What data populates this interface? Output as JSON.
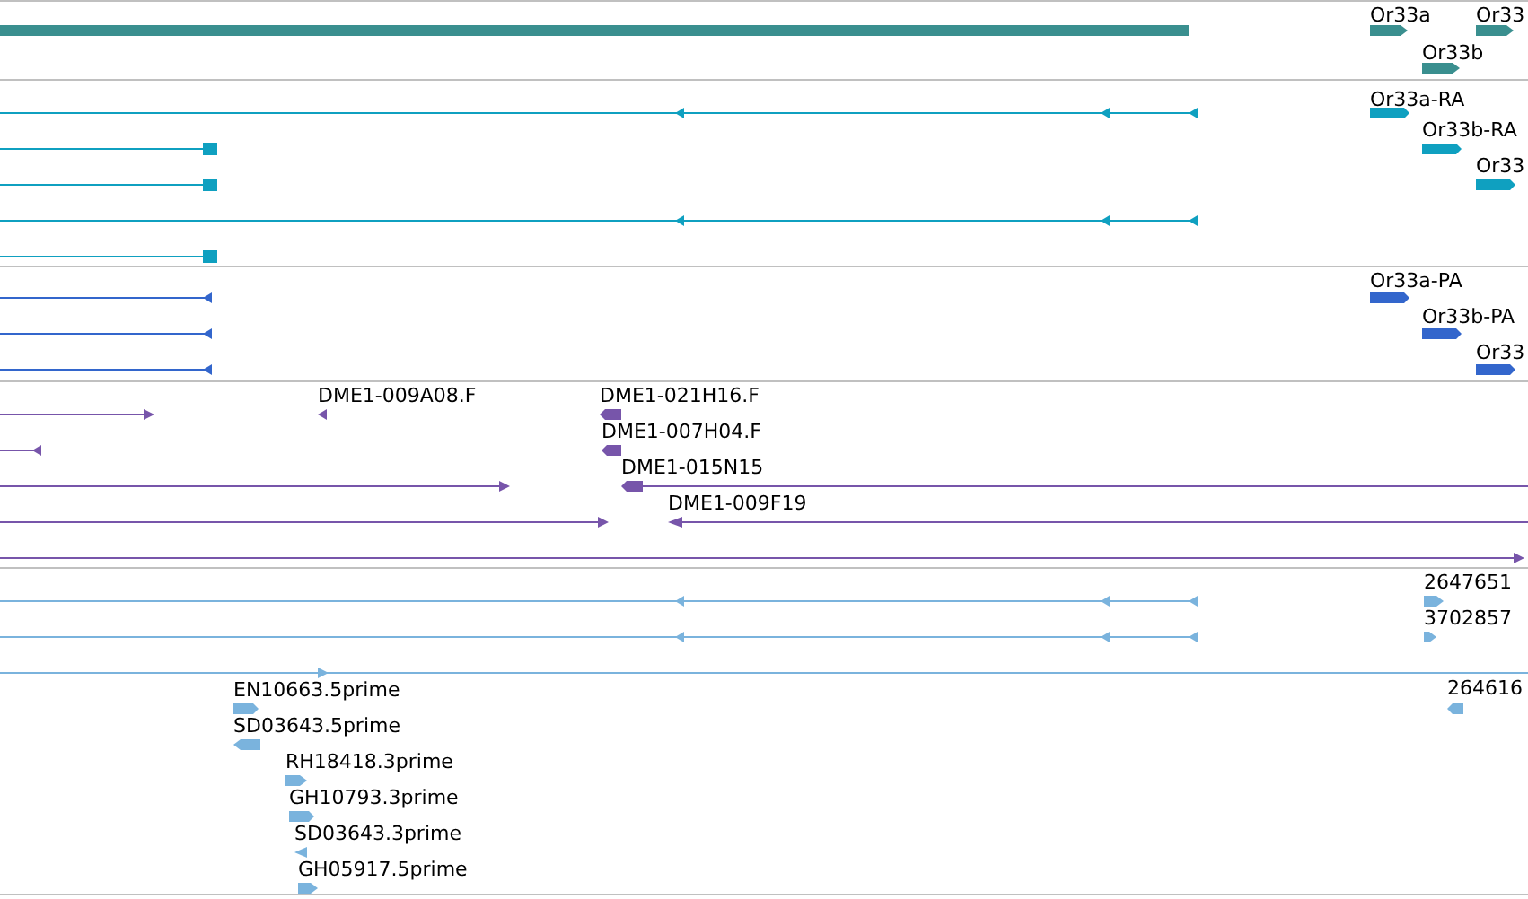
{
  "tracks": [
    {
      "color": "#3a8f8f",
      "features": [
        {
          "label": "Or33a"
        },
        {
          "label": "Or33"
        },
        {
          "label": "Or33b"
        }
      ]
    },
    {
      "color": "#0fa0c0",
      "features": [
        {
          "label": "Or33a-RA"
        },
        {
          "label": "Or33b-RA"
        },
        {
          "label": "Or33"
        }
      ]
    },
    {
      "color": "#3366cc",
      "features": [
        {
          "label": "Or33a-PA"
        },
        {
          "label": "Or33b-PA"
        },
        {
          "label": "Or33"
        }
      ]
    },
    {
      "color": "#7755aa",
      "features": [
        {
          "label": "DME1-009A08.F"
        },
        {
          "label": "DME1-021H16.F"
        },
        {
          "label": "DME1-007H04.F"
        },
        {
          "label": "DME1-015N15"
        },
        {
          "label": "DME1-009F19"
        }
      ]
    },
    {
      "color": "#7ab3dd",
      "features": [
        {
          "label": "2647651"
        },
        {
          "label": "3702857"
        },
        {
          "label": "264616"
        },
        {
          "label": "EN10663.5prime"
        },
        {
          "label": "SD03643.5prime"
        },
        {
          "label": "RH18418.3prime"
        },
        {
          "label": "GH10793.3prime"
        },
        {
          "label": "SD03643.3prime"
        },
        {
          "label": "GH05917.5prime"
        }
      ]
    }
  ]
}
